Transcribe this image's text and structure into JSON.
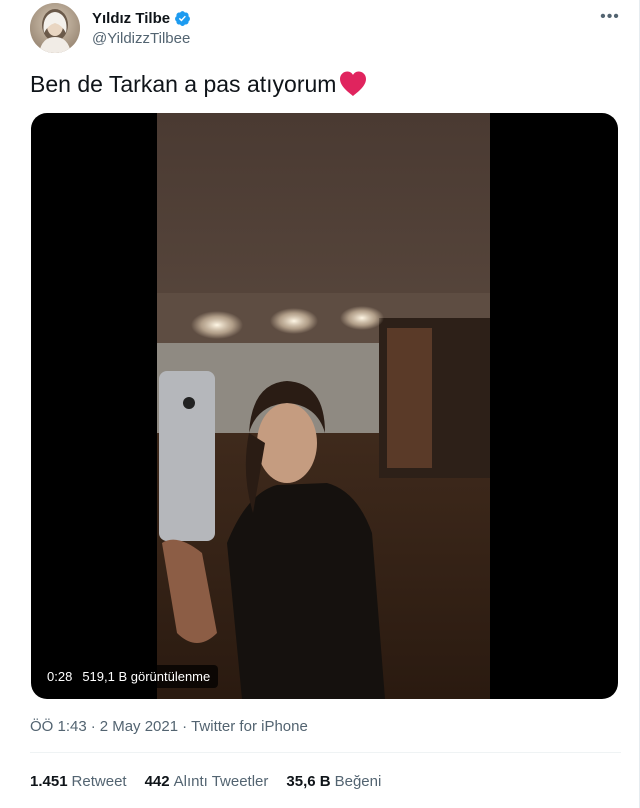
{
  "author": {
    "display_name": "Yıldız Tilbe",
    "handle": "@YildizzTilbee",
    "verified": true
  },
  "tweet": {
    "text": "Ben de Tarkan a pas atıyorum",
    "emoji": "red-heart"
  },
  "video": {
    "duration": "0:28",
    "views": "519,1 B görüntülenme"
  },
  "meta": {
    "time": "ÖÖ 1:43",
    "sep1": "·",
    "date": "2 May 2021",
    "sep2": "·",
    "source": "Twitter for iPhone"
  },
  "stats": {
    "retweets_count": "1.451",
    "retweets_label": "Retweet",
    "quotes_count": "442",
    "quotes_label": "Alıntı Tweetler",
    "likes_count": "35,6 B",
    "likes_label": "Beğeni"
  },
  "colors": {
    "verified_blue": "#1d9bf0",
    "secondary_text": "#536471",
    "heart_red": "#e0245e"
  },
  "icons": [
    "verified-badge-icon",
    "more-options-icon",
    "red-heart-emoji"
  ]
}
